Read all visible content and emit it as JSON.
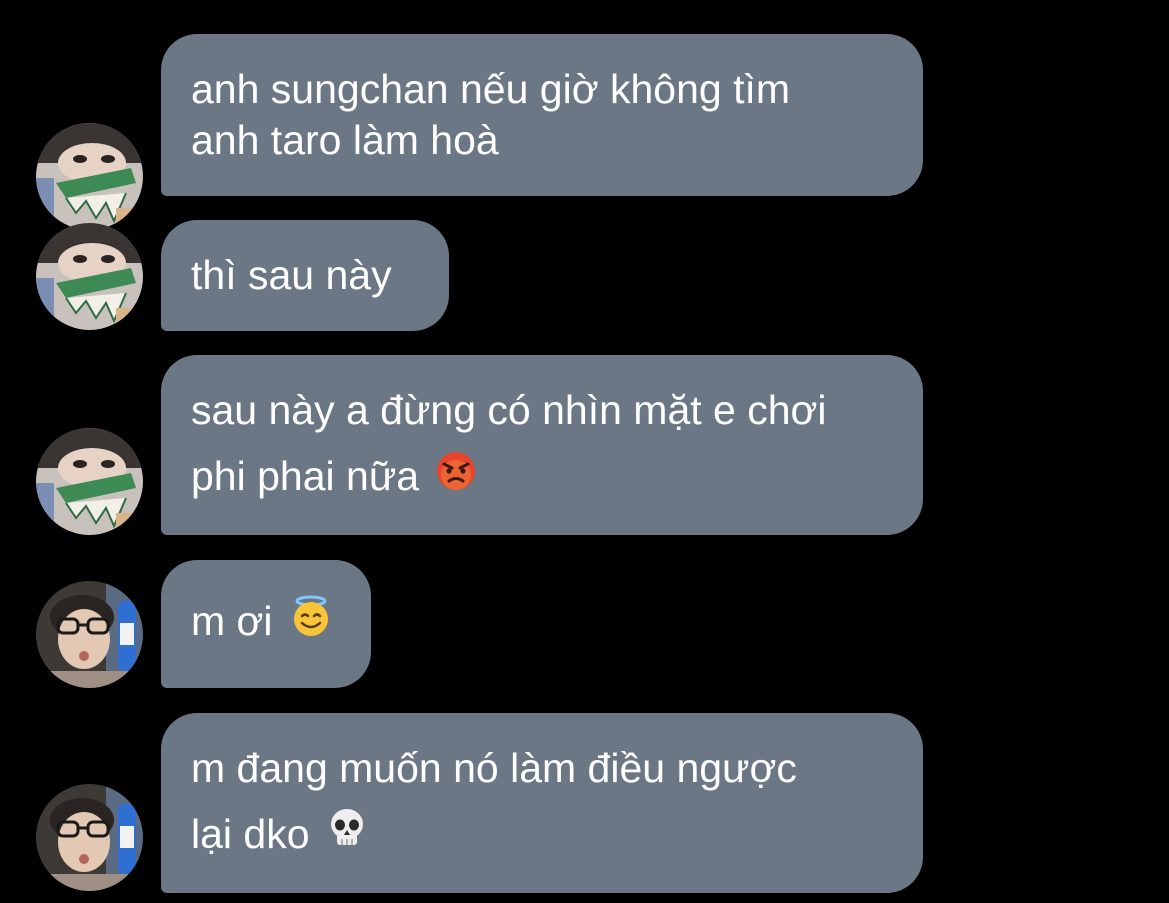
{
  "conversation": {
    "messages": [
      {
        "sender": "friend-a",
        "lines": [
          "anh sungchan nếu giờ không tìm",
          "anh taro làm hoà"
        ],
        "emoji": ""
      },
      {
        "sender": "friend-a",
        "lines": [
          "thì sau này"
        ],
        "emoji": ""
      },
      {
        "sender": "friend-a",
        "lines": [
          "sau này a đừng có nhìn mặt e chơi",
          "phi phai nữa"
        ],
        "emoji": "angry-face"
      },
      {
        "sender": "friend-b",
        "lines": [
          "m ơi"
        ],
        "emoji": "smiling-face-with-halo"
      },
      {
        "sender": "friend-b",
        "lines": [
          "m đang muốn nó làm điều ngược",
          "lại dko"
        ],
        "emoji": "skull"
      }
    ]
  },
  "colors": {
    "background": "#000000",
    "bubble": "#6b7785",
    "text": "#ffffff"
  }
}
